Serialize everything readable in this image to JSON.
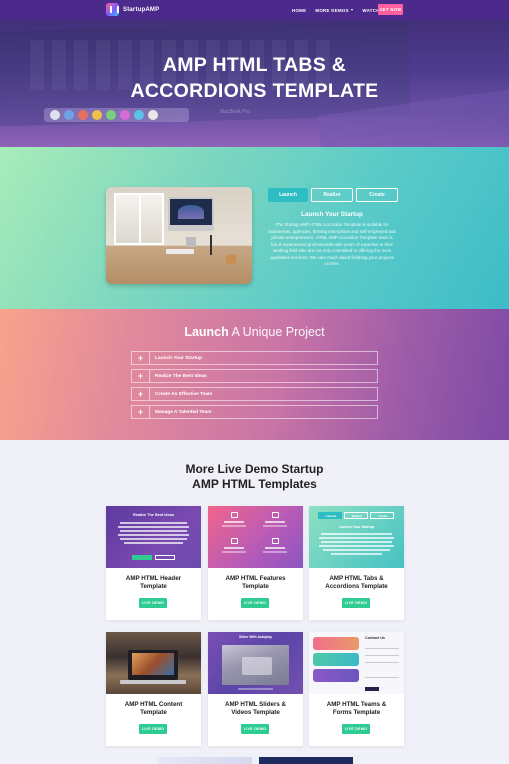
{
  "nav": {
    "brand": "StartupAMP",
    "items": [
      "HOME",
      "MORE DEMOS",
      "WATCH VIDEO"
    ],
    "cta": "GET NOW"
  },
  "hero": {
    "title_line1": "AMP HTML TABS &",
    "title_line2": "ACCORDIONS TEMPLATE",
    "device_label": "MacBook Pro"
  },
  "tabs_section": {
    "tabs": [
      "Launch",
      "Realize",
      "Create"
    ],
    "active_tab": "Launch",
    "title": "Launch Your Startup",
    "body": "The Startup AMP HTML Accordion Template is suitable for businesses, agencies, thriving enterprises and self-employed and private entrepreneurs. HTML AMP Accordion Template team is full of experienced professionals with years of expertise in their working field who are not only committed to offering the most qualitative services. We care much about finishing your projects on time."
  },
  "accordion_section": {
    "title_bold": "Launch",
    "title_rest": " A Unique Project",
    "items": [
      "Launch Your Startup",
      "Realize The Best Ideas",
      "Create An Effective Team",
      "Manage A Talented Team"
    ]
  },
  "templates_section": {
    "title_line1": "More Live Demo Startup",
    "title_line2": "AMP HTML Templates",
    "button_label": "LIVE DEMO",
    "cards": [
      {
        "name_line1": "AMP HTML Header",
        "name_line2": "Template"
      },
      {
        "name_line1": "AMP HTML Features",
        "name_line2": "Template"
      },
      {
        "name_line1": "AMP HTML Tabs &",
        "name_line2": "Accordions Template"
      },
      {
        "name_line1": "AMP HTML Content",
        "name_line2": "Template"
      },
      {
        "name_line1": "AMP HTML Sliders &",
        "name_line2": "Videos Template"
      },
      {
        "name_line1": "AMP HTML Teams &",
        "name_line2": "Forms Template"
      }
    ],
    "thumbs": {
      "header": {
        "title": "Realize The Best Ideas"
      },
      "tabs": {
        "tabs": [
          "Launch",
          "Realize",
          "Create"
        ],
        "title": "Launch Your Startup"
      },
      "slider": {
        "title": "Slider With Autoplay"
      },
      "forms": {
        "title": "Contact Us"
      }
    }
  },
  "colors": {
    "nav": "#4b2a8c",
    "accent_pink": "#ff5f9e",
    "live_demo": "#2ecc93",
    "tab_active": "#2dbdc3"
  }
}
